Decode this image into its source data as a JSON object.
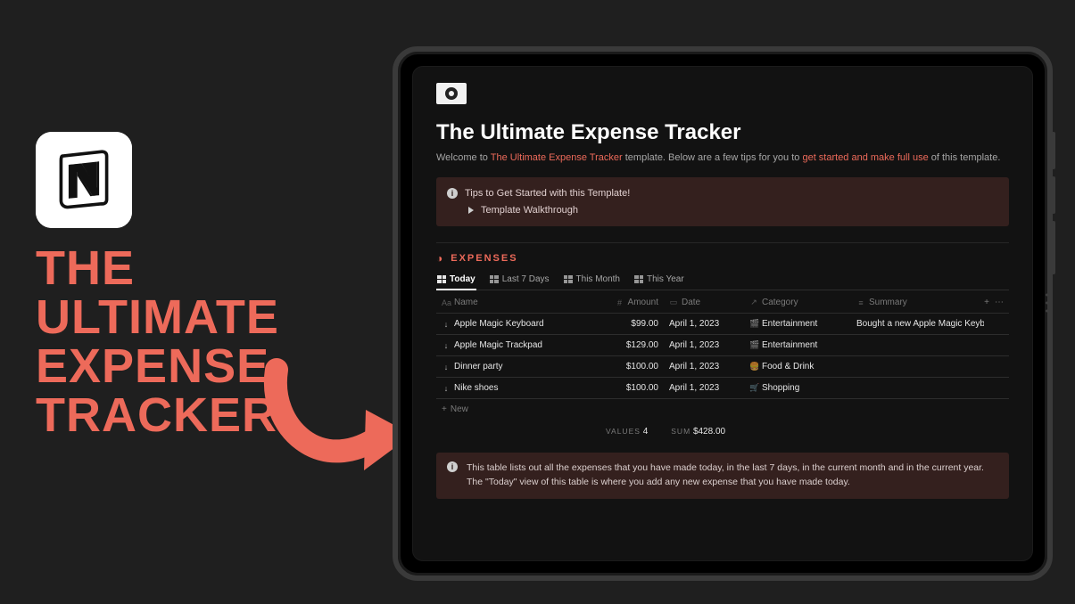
{
  "promo": {
    "title_line1": "THE ULTIMATE",
    "title_line2": "EXPENSE",
    "title_line3": "TRACKER"
  },
  "page": {
    "title": "The Ultimate Expense Tracker",
    "welcome_pre": "Welcome to ",
    "welcome_link1": "The Ultimate Expense Tracker",
    "welcome_mid": " template. Below are a few tips for you to ",
    "welcome_link2": "get started and make full use",
    "welcome_post": " of this template."
  },
  "callout_tips": {
    "line1": "Tips to Get Started with this Template!",
    "line2": "Template Walkthrough"
  },
  "expenses": {
    "section_label": "EXPENSES",
    "tabs": [
      "Today",
      "Last 7 Days",
      "This Month",
      "This Year"
    ],
    "columns": {
      "name": "Name",
      "amount": "Amount",
      "date": "Date",
      "category": "Category",
      "summary": "Summary"
    },
    "rows": [
      {
        "name": "Apple Magic Keyboard",
        "amount": "$99.00",
        "date": "April 1, 2023",
        "cat_icon": "🎬",
        "category": "Entertainment",
        "summary": "Bought a new Apple Magic Keyboard"
      },
      {
        "name": "Apple Magic Trackpad",
        "amount": "$129.00",
        "date": "April 1, 2023",
        "cat_icon": "🎬",
        "category": "Entertainment",
        "summary": ""
      },
      {
        "name": "Dinner party",
        "amount": "$100.00",
        "date": "April 1, 2023",
        "cat_icon": "🍔",
        "category": "Food & Drink",
        "summary": ""
      },
      {
        "name": "Nike shoes",
        "amount": "$100.00",
        "date": "April 1, 2023",
        "cat_icon": "🛒",
        "category": "Shopping",
        "summary": ""
      }
    ],
    "new_row_label": "New",
    "footer": {
      "count_label": "VALUES",
      "count_value": "4",
      "sum_label": "SUM",
      "sum_value": "$428.00"
    }
  },
  "callout_info": {
    "text": "This table lists out all the expenses that you have made today, in the last 7 days, in the current month and in the current year. The \"Today\" view of this table is where you add any new expense that you have made today."
  },
  "chart_data": {
    "type": "table",
    "title": "Expenses — Today",
    "columns": [
      "Name",
      "Amount",
      "Date",
      "Category",
      "Summary"
    ],
    "rows": [
      [
        "Apple Magic Keyboard",
        99.0,
        "April 1, 2023",
        "Entertainment",
        "Bought a new Apple Magic Keyboard"
      ],
      [
        "Apple Magic Trackpad",
        129.0,
        "April 1, 2023",
        "Entertainment",
        ""
      ],
      [
        "Dinner party",
        100.0,
        "April 1, 2023",
        "Food & Drink",
        ""
      ],
      [
        "Nike shoes",
        100.0,
        "April 1, 2023",
        "Shopping",
        ""
      ]
    ],
    "aggregates": {
      "count": 4,
      "sum": 428.0,
      "sum_display": "$428.00"
    }
  }
}
